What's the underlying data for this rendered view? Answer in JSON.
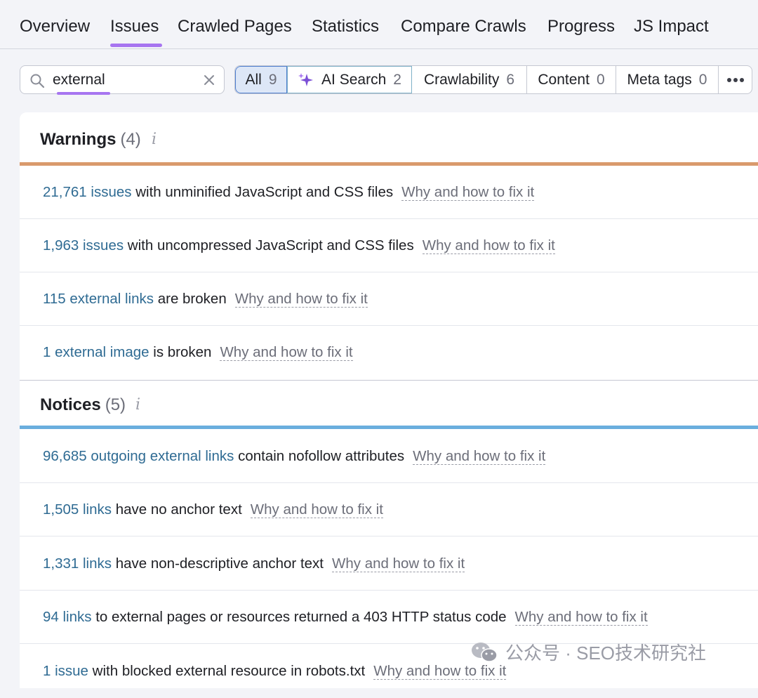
{
  "nav": {
    "tabs": [
      "Overview",
      "Issues",
      "Crawled Pages",
      "Statistics",
      "Compare Crawls",
      "Progress",
      "JS Impact"
    ],
    "active": "Issues"
  },
  "search": {
    "value": "external"
  },
  "filters": [
    {
      "label": "All",
      "count": "9"
    },
    {
      "label": "AI Search",
      "count": "2"
    },
    {
      "label": "Crawlability",
      "count": "6"
    },
    {
      "label": "Content",
      "count": "0"
    },
    {
      "label": "Meta tags",
      "count": "0"
    }
  ],
  "colors": {
    "accent": "#a775f0",
    "link": "#2f6b93",
    "warnings_bar": "#d99a6c",
    "notices_bar": "#6aaede"
  },
  "fix_label": "Why and how to fix it",
  "warnings": {
    "title": "Warnings",
    "count": "(4)",
    "info": "i",
    "items": [
      {
        "link": "21,761 issues",
        "rest": " with unminified JavaScript and CSS files"
      },
      {
        "link": "1,963 issues",
        "rest": " with uncompressed JavaScript and CSS files"
      },
      {
        "link": "115 external links",
        "rest": " are broken"
      },
      {
        "link": "1 external image",
        "rest": " is broken"
      }
    ]
  },
  "notices": {
    "title": "Notices",
    "count": "(5)",
    "info": "i",
    "items": [
      {
        "link": "96,685 outgoing external links",
        "rest": " contain nofollow attributes"
      },
      {
        "link": "1,505 links",
        "rest": " have no anchor text"
      },
      {
        "link": "1,331 links",
        "rest": " have non-descriptive anchor text"
      },
      {
        "link": "94 links",
        "rest": " to external pages or resources returned a 403 HTTP status code"
      },
      {
        "link": "1 issue",
        "rest": " with blocked external resource in robots.txt"
      }
    ]
  },
  "watermark": "公众号 · SEO技术研究社"
}
